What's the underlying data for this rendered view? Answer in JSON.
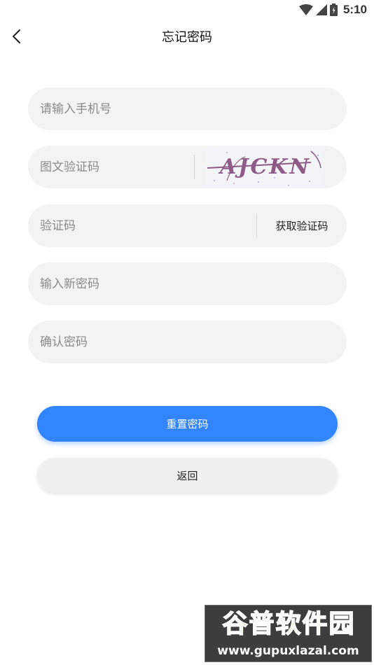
{
  "status_bar": {
    "time": "5:10"
  },
  "header": {
    "title": "忘记密码"
  },
  "form": {
    "phone": {
      "placeholder": "请输入手机号",
      "value": ""
    },
    "image_captcha": {
      "placeholder": "图文验证码",
      "value": "",
      "captcha_text": "AJCKN"
    },
    "sms_code": {
      "placeholder": "验证码",
      "value": "",
      "get_code_label": "获取验证码"
    },
    "new_password": {
      "placeholder": "输入新密码",
      "value": ""
    },
    "confirm_password": {
      "placeholder": "确认密码",
      "value": ""
    }
  },
  "buttons": {
    "reset_label": "重置密码",
    "back_label": "返回"
  },
  "watermark": {
    "brand": "谷普软件园",
    "url": "www.gupuxlazal.com"
  },
  "colors": {
    "primary": "#3385ff",
    "field_bg": "#f3f3f3",
    "captcha_ink": "#8e5a86",
    "watermark_green": "#7fbf3b"
  }
}
